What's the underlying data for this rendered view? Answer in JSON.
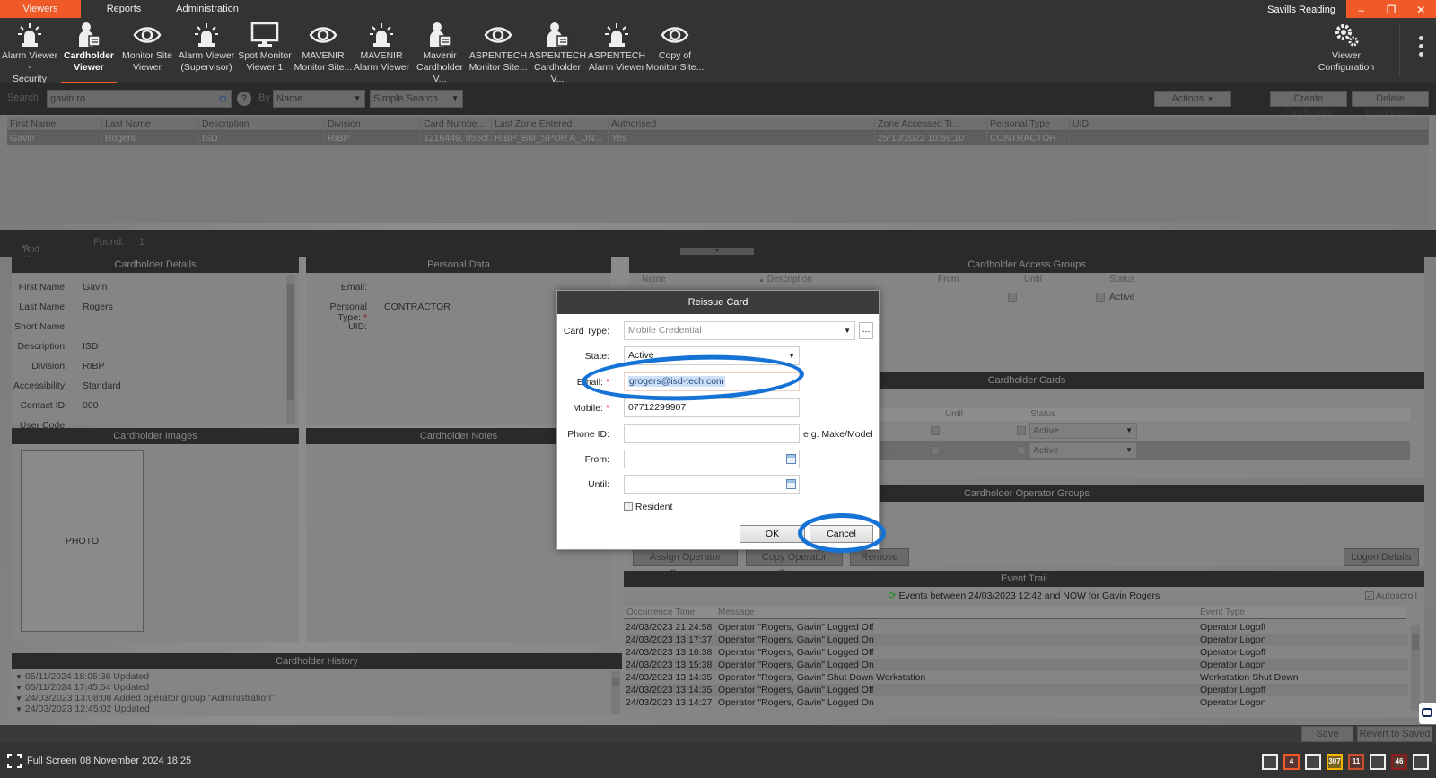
{
  "menu": {
    "tabs": [
      {
        "label": "Viewers",
        "active": true
      },
      {
        "label": "Reports",
        "active": false
      },
      {
        "label": "Administration",
        "active": false
      }
    ],
    "window_title": "Savills Reading",
    "window_controls": {
      "minimize": "–",
      "restore": "❐",
      "close": "✕"
    }
  },
  "ribbon": {
    "items": [
      {
        "line1": "Alarm Viewer -",
        "line2": "Security",
        "icon": "alarm-beacon-icon"
      },
      {
        "line1": "Cardholder",
        "line2": "Viewer",
        "icon": "cardholder-icon",
        "active": true
      },
      {
        "line1": "Monitor Site",
        "line2": "Viewer",
        "icon": "eye-icon"
      },
      {
        "line1": "Alarm Viewer",
        "line2": "(Supervisor)",
        "icon": "alarm-beacon-icon"
      },
      {
        "line1": "Spot Monitor",
        "line2": "Viewer 1",
        "icon": "monitor-icon"
      },
      {
        "line1": "MAVENIR",
        "line2": "Monitor Site...",
        "icon": "eye-icon"
      },
      {
        "line1": "MAVENIR",
        "line2": "Alarm Viewer",
        "icon": "alarm-beacon-icon"
      },
      {
        "line1": "Mavenir",
        "line2": "Cardholder V...",
        "icon": "cardholder-icon"
      },
      {
        "line1": "ASPENTECH",
        "line2": "Monitor Site...",
        "icon": "eye-icon"
      },
      {
        "line1": "ASPENTECH",
        "line2": "Cardholder V...",
        "icon": "cardholder-icon"
      },
      {
        "line1": "ASPENTECH",
        "line2": "Alarm Viewer",
        "icon": "alarm-beacon-icon"
      },
      {
        "line1": "Copy of",
        "line2": "Monitor Site...",
        "icon": "eye-icon"
      }
    ],
    "config": {
      "line1": "Viewer",
      "line2": "Configuration"
    }
  },
  "search": {
    "label": "Search",
    "value": "gavin ro",
    "help": "?",
    "by_label": "By",
    "by_value": "Name",
    "mode_value": "Simple Search",
    "actions_label": "Actions",
    "create_label": "Create Cardholder",
    "delete_label": "Delete Cardholder"
  },
  "results": {
    "columns": [
      "First Name",
      "Last Name",
      "Description",
      "Division",
      "Card Numbe...",
      "Last Zone Entered",
      "Authorised",
      "Zone Accessed Ti...",
      "Personal Type",
      "UID"
    ],
    "rows": [
      [
        "Gavin",
        "Rogers",
        "ISD",
        "RIBP",
        "1216449, 956cf...",
        "RIBP_BM_SPUR A_UN...",
        "Yes",
        "25/10/2022 10:59:10",
        "CONTRACTOR",
        ""
      ]
    ],
    "text_size_label": "Text Size",
    "found_label": "Found:",
    "found_count": "1"
  },
  "cardholder_details": {
    "title": "Cardholder Details",
    "fields": [
      {
        "label": "First Name:",
        "value": "Gavin"
      },
      {
        "label": "Last Name:",
        "value": "Rogers"
      },
      {
        "label": "Short Name:",
        "value": ""
      },
      {
        "label": "Description:",
        "value": "ISD"
      },
      {
        "label": "Division:",
        "value": "RIBP"
      },
      {
        "label": "Accessibility:",
        "value": "Standard"
      },
      {
        "label": "Contact ID:",
        "value": "000"
      },
      {
        "label": "User Code:",
        "value": ""
      }
    ]
  },
  "personal_data": {
    "title": "Personal Data",
    "email_label": "Email:",
    "type_label": "Personal Type:",
    "type_value": "CONTRACTOR",
    "uid_label": "UID:"
  },
  "images": {
    "title": "Cardholder Images",
    "photo_label": "PHOTO"
  },
  "notes": {
    "title": "Cardholder Notes"
  },
  "history": {
    "title": "Cardholder History",
    "entries": [
      "05/11/2024 18:05:36 Updated",
      "05/11/2024 17:45:54 Updated",
      "24/03/2023 13:08:08 Added operator group \"Administration\"",
      "24/03/2023 12:45:02 Updated"
    ]
  },
  "access_groups": {
    "title": "Cardholder Access Groups",
    "columns": [
      "Name",
      "Description",
      "From",
      "Until",
      "Status"
    ],
    "row_status": "Active"
  },
  "cards": {
    "title": "Cardholder Cards",
    "columns": [
      "Until",
      "Status"
    ],
    "rows": [
      {
        "status": "Active"
      },
      {
        "status": "Active"
      }
    ]
  },
  "operator_groups": {
    "title": "Cardholder Operator Groups",
    "assign_label": "Assign Operator Groups",
    "copy_label": "Copy Operator Groups",
    "remove_label": "Remove",
    "logon_label": "Logon Details"
  },
  "event_trail": {
    "title": "Event Trail",
    "summary": "Events between 24/03/2023 12:42 and NOW for Gavin Rogers",
    "autoscroll_label": "Autoscroll",
    "autoscroll_checked": true,
    "columns": [
      "Occurrence Time",
      "Message",
      "Event Type"
    ],
    "rows": [
      [
        "24/03/2023 21:24:58",
        "Operator \"Rogers, Gavin\" Logged Off",
        "Operator Logoff"
      ],
      [
        "24/03/2023 13:17:37",
        "Operator \"Rogers, Gavin\" Logged On",
        "Operator Logon"
      ],
      [
        "24/03/2023 13:16:38",
        "Operator \"Rogers, Gavin\" Logged Off",
        "Operator Logoff"
      ],
      [
        "24/03/2023 13:15:38",
        "Operator \"Rogers, Gavin\" Logged On",
        "Operator Logon"
      ],
      [
        "24/03/2023 13:14:35",
        "Operator \"Rogers, Gavin\" Shut Down Workstation",
        "Workstation Shut Down"
      ],
      [
        "24/03/2023 13:14:35",
        "Operator \"Rogers, Gavin\" Logged Off",
        "Operator Logoff"
      ],
      [
        "24/03/2023 13:14:27",
        "Operator \"Rogers, Gavin\" Logged On",
        "Operator Logon"
      ]
    ]
  },
  "save_bar": {
    "save_label": "Save",
    "revert_label": "Revert to Saved"
  },
  "status_bar": {
    "fullscreen_label": "Full Screen",
    "datetime": "08 November 2024 18:25",
    "indicators": [
      {
        "value": "",
        "color": "#eeeeee"
      },
      {
        "value": "4",
        "color": "#f05a28"
      },
      {
        "value": "",
        "color": "#eeeeee"
      },
      {
        "value": "307",
        "color": "#f5b400"
      },
      {
        "value": "11",
        "color": "#c9502a"
      },
      {
        "value": "",
        "color": "#eeeeee"
      },
      {
        "value": "46",
        "color": "#8a1c1c"
      },
      {
        "value": "",
        "color": "#eeeeee"
      }
    ]
  },
  "dialog": {
    "title": "Reissue Card",
    "card_type_label": "Card Type:",
    "card_type_value": "Mobile Credential",
    "card_type_more": "...",
    "state_label": "State:",
    "state_value": "Active",
    "email_label": "Email:",
    "email_value": "grogers@isd-tech.com",
    "mobile_label": "Mobile:",
    "mobile_value": "07712299907",
    "phone_label": "Phone ID:",
    "phone_value": "",
    "phone_hint": "e.g. Make/Model",
    "from_label": "From:",
    "until_label": "Until:",
    "resident_label": "Resident",
    "resident_checked": false,
    "ok_label": "OK",
    "cancel_label": "Cancel",
    "required_mark": "*"
  },
  "colors": {
    "accent": "#f05a28",
    "annotation": "#1673d6"
  }
}
